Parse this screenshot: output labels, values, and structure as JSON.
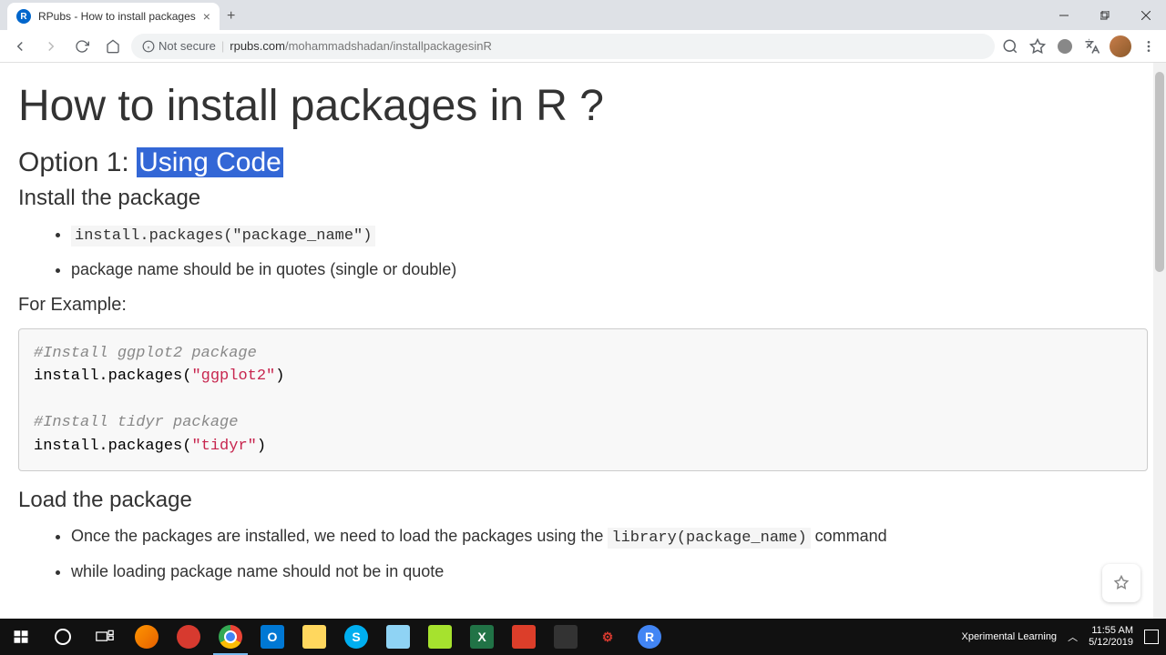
{
  "browser": {
    "tab_title": "RPubs - How to install packages",
    "tab_favicon": "R",
    "address": {
      "security": "Not secure",
      "domain": "rpubs.com",
      "path": "/mohammadshadan/installpackagesinR"
    }
  },
  "article": {
    "title": "How to install packages in R ?",
    "section1": {
      "heading_prefix": "Option 1: ",
      "heading_selected": "Using Code",
      "sub1": "Install the package",
      "bullet1_code": "install.packages(\"package_name\")",
      "bullet2": "package name should be in quotes (single or double)",
      "example_label": "For Example:",
      "code": {
        "c1": "#Install ggplot2 package",
        "l1a": "install.packages(",
        "l1b": "\"ggplot2\"",
        "l1c": ")",
        "c2": "#Install tidyr package",
        "l2a": "install.packages(",
        "l2b": "\"tidyr\"",
        "l2c": ")"
      },
      "sub2": "Load the package",
      "bullet3_a": "Once the packages are installed, we need to load the packages using the ",
      "bullet3_code": "library(package_name)",
      "bullet3_b": " command",
      "bullet4": "while loading package name should not be in quote"
    }
  },
  "taskbar": {
    "tray_label": "Xperimental Learning",
    "time": "11:55 AM",
    "date": "5/12/2019"
  }
}
